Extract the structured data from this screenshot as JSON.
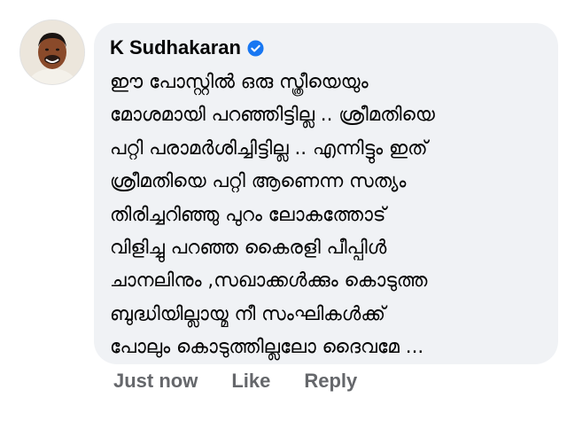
{
  "comment": {
    "author": "K Sudhakaran",
    "verified_icon": "verified-badge-icon",
    "verified_color": "#1877f2",
    "lines": [
      "ഈ പോസ്റ്റിൽ ഒരു സ്ത്രീയെയും",
      "മോശമായി പറഞ്ഞിട്ടില്ല .. ശ്രീമതിയെ",
      "പറ്റി പരാമർശിച്ചിട്ടില്ല .. എന്നിട്ടും ഇത്",
      "ശ്രീമതിയെ പറ്റി ആണെന്ന സത്യം",
      "തിരിച്ചറിഞ്ഞു പുറം ലോകത്തോട്",
      "വിളിച്ചു പറഞ്ഞ കൈരളി പീപ്പിൾ",
      "ചാനലിനും ,സഖാക്കൾക്കും കൊടുത്ത",
      "ബുദ്ധിയില്ലായ്മ നീ സംഘികൾക്ക്",
      "പോലും കൊടുത്തില്ലലോ ദൈവമേ ..."
    ]
  },
  "actions": {
    "timestamp": "Just now",
    "like_label": "Like",
    "reply_label": "Reply"
  },
  "colors": {
    "bubble_bg": "#f0f2f5",
    "meta_text": "#65676b",
    "body_text": "#050505"
  }
}
